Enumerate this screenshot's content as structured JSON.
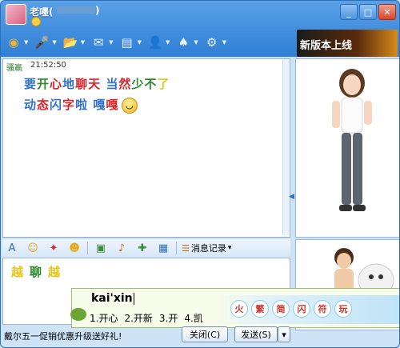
{
  "window": {
    "title": "老嚜(",
    "title_suffix": ")"
  },
  "toolbar": {
    "items": [
      {
        "name": "video-icon",
        "glyph": "◉",
        "color": "#f2b338"
      },
      {
        "name": "microphone-icon",
        "glyph": "🎤",
        "color": "#dbe9f8"
      },
      {
        "name": "folder-transfer-icon",
        "glyph": "📂",
        "color": "#f7d76a"
      },
      {
        "name": "email-icon",
        "glyph": "✉",
        "color": "#e9f2fb"
      },
      {
        "name": "sms-icon",
        "glyph": "▤",
        "color": "#e9f2fb"
      },
      {
        "name": "user-group-icon",
        "glyph": "👤",
        "color": "#e9f2fb"
      },
      {
        "name": "game-icon",
        "glyph": "♠",
        "color": "#e9f2fb"
      },
      {
        "name": "settings-icon",
        "glyph": "⚙",
        "color": "#e9f2fb"
      }
    ]
  },
  "banner": {
    "text": "新版本上线"
  },
  "chat": {
    "sender": "骚嬴",
    "time": "21:52:50",
    "line1": [
      {
        "t": "要",
        "c": "#2f72c8"
      },
      {
        "t": "开",
        "c": "#2b8a2b"
      },
      {
        "t": "心",
        "c": "#d8262b"
      },
      {
        "t": "地",
        "c": "#2f72c8"
      },
      {
        "t": "聊",
        "c": "#d8262b"
      },
      {
        "t": "天",
        "c": "#d8262b"
      },
      {
        "t": " ",
        "c": "#000"
      },
      {
        "t": "当",
        "c": "#2f72c8"
      },
      {
        "t": "然",
        "c": "#d8262b"
      },
      {
        "t": "少",
        "c": "#2b8a2b"
      },
      {
        "t": "不",
        "c": "#2b8a2b"
      },
      {
        "t": "了",
        "c": "#e7c61b"
      }
    ],
    "line2": [
      {
        "t": "动",
        "c": "#2f72c8"
      },
      {
        "t": "态",
        "c": "#d8262b"
      },
      {
        "t": "闪",
        "c": "#2f72c8"
      },
      {
        "t": "字",
        "c": "#d8262b"
      },
      {
        "t": "啦",
        "c": "#2f72c8"
      },
      {
        "t": "  ",
        "c": "#000"
      },
      {
        "t": "嘎",
        "c": "#2f72c8"
      },
      {
        "t": "嘎",
        "c": "#d8262b"
      }
    ],
    "emoji": "grin-emoji"
  },
  "input_toolbar": {
    "icons": [
      "font-icon",
      "smiley-icon",
      "magic-icon",
      "face-icon",
      "screenshot-icon",
      "photo-icon",
      "gift-icon",
      "music-icon"
    ],
    "history_label": "消息记录"
  },
  "input": {
    "chars": [
      {
        "t": "越",
        "c": "#e7c61b"
      },
      {
        "t": "聊",
        "c": "#2b8a2b"
      },
      {
        "t": "越",
        "c": "#e7c61b"
      }
    ]
  },
  "ime": {
    "composition": "kai'xin",
    "candidates": [
      "1.开心",
      "2.开新",
      "3.开",
      "4.凯"
    ],
    "banner_chars": [
      "火",
      "繁",
      "简",
      "闪",
      "符",
      "玩"
    ]
  },
  "bottom": {
    "promo": "戴尔五一促销优惠升级送好礼!",
    "close_label": "关闭(C)",
    "send_label": "发送(S)"
  }
}
